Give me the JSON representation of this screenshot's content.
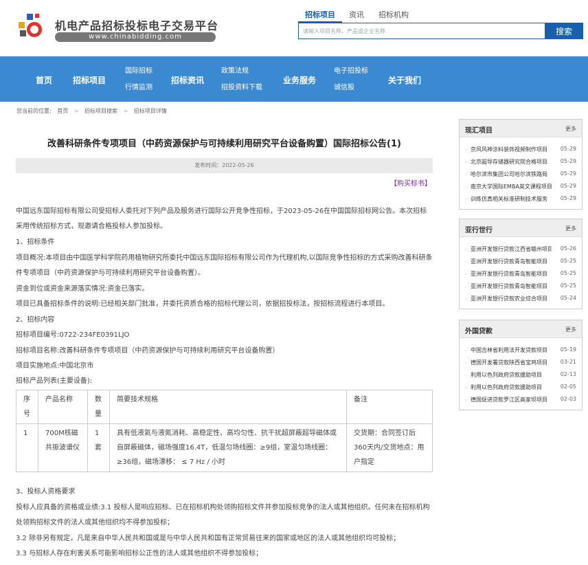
{
  "site": {
    "name": "机电产品招标投标电子交易平台",
    "url": "www.chinabidding.com"
  },
  "search": {
    "tabs": [
      "招标项目",
      "资讯",
      "招标机构"
    ],
    "placeholder": "请输入项目名称、产品或企业名称",
    "button": "搜索"
  },
  "nav": {
    "home": "首页",
    "projects": "招标项目",
    "intl_1": "国际招标",
    "intl_2": "行情监测",
    "news": "招标资讯",
    "policy_1": "政策法规",
    "policy_2": "招投资料下载",
    "services": "业务服务",
    "ebid_1": "电子招投标",
    "ebid_2": "诚信股",
    "about": "关于我们"
  },
  "breadcrumb": {
    "prefix": "您当前的位置:",
    "home": "首页",
    "search": "招标项目搜索",
    "detail": "招标项目详情",
    "sep": ">"
  },
  "article": {
    "title": "改善科研条件专项项目（中药资源保护与可持续利用研究平台设备购置）国际招标公告(1)",
    "pub_time": "发布时间：2022-05-26",
    "buy": "【购买标书】",
    "intro": "中国远东国际招标有限公司受招标人委托对下列产品及服务进行国际公开竞争性招标，于2023-05-26在中国国际招标网公告。本次招标采用传统招标方式，现邀请合格投标人参加投标。",
    "s1": "1、招标条件",
    "overview": "项目概况:本项目由中国医学科学院药用植物研究所委托中国远东国际招标有限公司作为代理机构,以国际竞争性招标的方式采购改善科研条件专项项目（中药资源保护与可持续利用研究平台设备购置）。",
    "funds": "资金到位或资金来源落实情况:资金已落实。",
    "ready": "项目已具备招标条件的说明:已经相关部门批准，并委托资质合格的招标代理公司，依据招投标法，按招标流程进行本项目。",
    "s2": "2、招标内容",
    "code": "招标项目编号:0722-234FE0391LJO",
    "name": "招标项目名称:改善科研条件专项项目（中药资源保护与可持续利用研究平台设备购置）",
    "place": "项目实施地点:中国北京市",
    "list": "招标产品列表(主要设备):",
    "table": {
      "headers": [
        "序号",
        "产品名称",
        "数量",
        "简要技术规格",
        "备注"
      ],
      "row": [
        "1",
        "700M核磁共振波谱仪",
        "1套",
        "具有低液氦与液氮消耗、高稳定性、高均匀性、抗干扰超屏蔽超导磁体或自屏蔽磁体，磁场强度16.4T，低温匀场线圈：≥9组，室温匀场线圈：≥36组，磁场漂移： ≤ 7 Hz / 小时",
        "交货期：合同签订后360天内/交货地点：用户指定"
      ]
    },
    "s3": "3、投标人资格要求",
    "q1": "投标人应具备的资格或业绩:3.1 投标人是响应招标、已在招标机构处领购招标文件并参加投标竞争的法人或其他组织。任何未在招标机构处领购招标文件的法人或其他组织均不得参加投标；",
    "q2": "3.2 除非另有规定，凡是来自中华人民共和国或是与中华人民共和国有正常贸易往来的国家或地区的法人或其他组织均可投标；",
    "q3": "3.3 与招标人存在利害关系可能影响招标公正性的法人或其他组织不得参加投标；"
  },
  "sidebar": {
    "more": "更多",
    "boxes": [
      {
        "title": "现汇项目",
        "items": [
          {
            "text": "京风风神涂料装饰视频制作项目",
            "date": "05-29"
          },
          {
            "text": "北京超导存储器研究院合格项目",
            "date": "05-29"
          },
          {
            "text": "哈尔滨市集团公司哈尔滨铁路局",
            "date": "05-29"
          },
          {
            "text": "南京大学国际EMBA英文课程项目",
            "date": "05-29"
          },
          {
            "text": "训练仿真相关标准研制技术服务",
            "date": "05-29"
          }
        ]
      },
      {
        "title": "亚行世行",
        "items": [
          {
            "text": "亚洲开发银行贷款江西省赣州项目",
            "date": "05-26"
          },
          {
            "text": "亚洲开发银行贷款青岛智能项目",
            "date": "05-25"
          },
          {
            "text": "亚洲开发银行贷款青岛智能项目",
            "date": "05-25"
          },
          {
            "text": "亚洲开发银行贷款青岛智能项目",
            "date": "05-25"
          },
          {
            "text": "亚洲开发银行贷款农业综合项目",
            "date": "05-24"
          }
        ]
      },
      {
        "title": "外国贷款",
        "items": [
          {
            "text": "中国吉林省利用法开发贷款项目",
            "date": "05-19"
          },
          {
            "text": "德国开发署贷款陕西省宝鸡项目",
            "date": "03-21"
          },
          {
            "text": "利用以色列政府贷款援助项目",
            "date": "02-13"
          },
          {
            "text": "利用以色列政府贷款援助项目",
            "date": "02-05"
          },
          {
            "text": "德国促进贷款罗江区高家坝项目",
            "date": "02-03"
          }
        ]
      }
    ]
  }
}
